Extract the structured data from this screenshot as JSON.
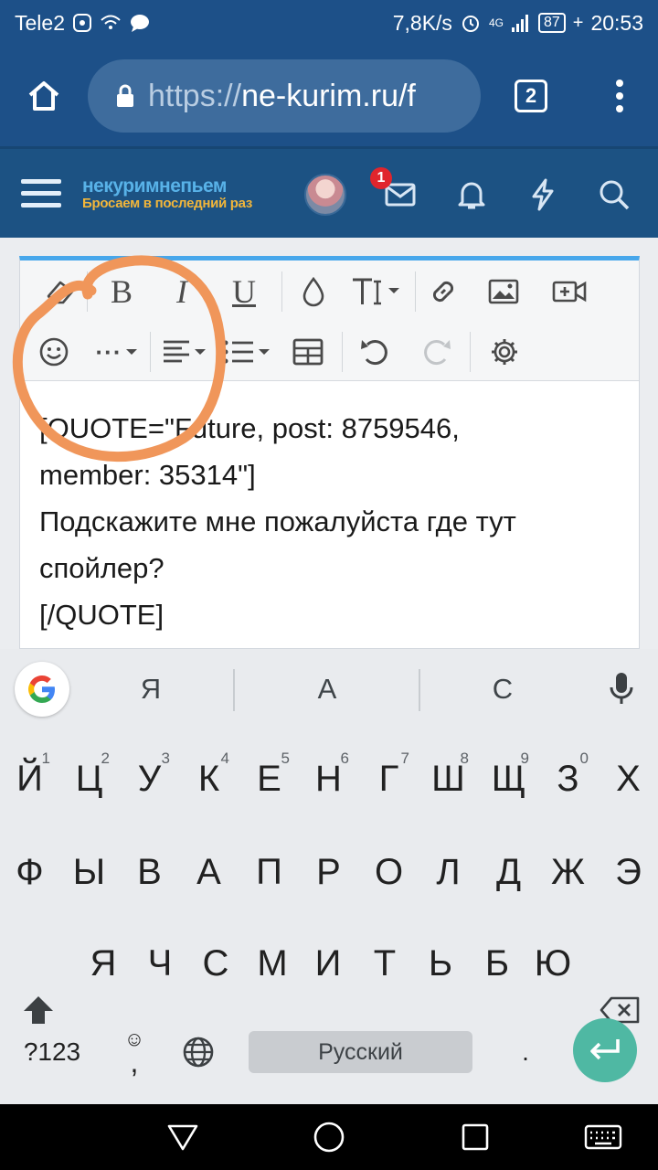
{
  "status_bar": {
    "carrier": "Tele2",
    "speed": "7,8K/s",
    "network": "4G",
    "battery": "87",
    "time": "20:53"
  },
  "browser": {
    "url_scheme": "https://",
    "url_host": "ne-kurim.ru/f",
    "tab_count": "2"
  },
  "site": {
    "logo_main": "некуримнепьем",
    "logo_sub": "Бросаем в последний раз",
    "notification_count": "1"
  },
  "editor": {
    "lines": [
      "[QUOTE=\"Future, post: 8759546,",
      "member: 35314\"]",
      "Подскажите мне пожалуйста где тут",
      "спойлер?",
      "[/QUOTE]"
    ],
    "toolbar": {
      "bold": "B",
      "italic": "I",
      "underline": "U",
      "more": "···"
    }
  },
  "keyboard": {
    "suggestions": [
      "Я",
      "А",
      "С"
    ],
    "row1": [
      "Й",
      "Ц",
      "У",
      "К",
      "Е",
      "Н",
      "Г",
      "Ш",
      "Щ",
      "З",
      "Х"
    ],
    "row1_hints": [
      "1",
      "2",
      "3",
      "4",
      "5",
      "6",
      "7",
      "8",
      "9",
      "0",
      ""
    ],
    "row2": [
      "Ф",
      "Ы",
      "В",
      "А",
      "П",
      "Р",
      "О",
      "Л",
      "Д",
      "Ж",
      "Э"
    ],
    "row3": [
      "Я",
      "Ч",
      "С",
      "М",
      "И",
      "Т",
      "Ь",
      "Б",
      "Ю"
    ],
    "symbols_key": "?123",
    "comma": ",",
    "space_label": "Русский",
    "period": "."
  },
  "colors": {
    "header_blue": "#1d5088",
    "editor_accent": "#47a7eb",
    "annotation_orange": "#f0965a",
    "enter_green": "#4fb8a3",
    "badge_red": "#e0252d"
  }
}
